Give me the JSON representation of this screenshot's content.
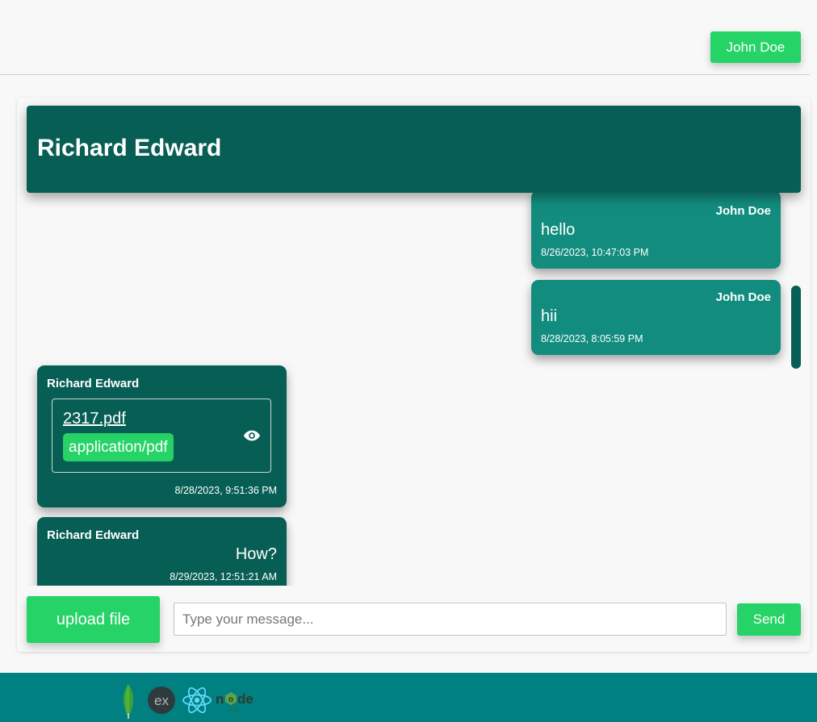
{
  "header": {
    "user_label": "John Doe"
  },
  "chat": {
    "contact_name": "Richard Edward",
    "messages": [
      {
        "sender": "John Doe",
        "text": "hello",
        "time": "8/26/2023, 10:47:03 PM",
        "direction": "outgoing"
      },
      {
        "sender": "John Doe",
        "text": "hii",
        "time": "8/28/2023, 8:05:59 PM",
        "direction": "outgoing"
      },
      {
        "sender": "Richard Edward",
        "file": {
          "name": "2317.pdf",
          "type": "application/pdf",
          "icon": "eye-icon"
        },
        "time": "8/28/2023, 9:51:36 PM",
        "direction": "incoming"
      },
      {
        "sender": "Richard Edward",
        "text": "How?",
        "time": "8/29/2023, 12:51:21 AM",
        "direction": "incoming"
      }
    ]
  },
  "composer": {
    "upload_label": "upload file",
    "placeholder": "Type your message...",
    "send_label": "Send"
  },
  "footer": {
    "logos": [
      "mongodb-logo",
      "express-logo",
      "react-logo",
      "node-logo"
    ]
  },
  "colors": {
    "accent": "#25d366",
    "header": "#075e54",
    "outgoing": "#128c7e",
    "incoming": "#075e54",
    "footer": "#008080"
  }
}
